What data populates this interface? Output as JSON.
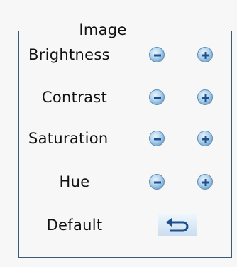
{
  "panel": {
    "title": "Image",
    "rows": [
      {
        "label": "Brightness"
      },
      {
        "label": "Contrast"
      },
      {
        "label": "Saturation"
      },
      {
        "label": "Hue"
      }
    ],
    "default_label": "Default"
  },
  "icons": {
    "decrease": "minus-circle-icon",
    "increase": "plus-circle-icon",
    "reset": "return-arrow-icon"
  },
  "colors": {
    "border": "#3b5a74",
    "button_blue": "#5b90bd",
    "glyph": "#1f4f8c"
  }
}
